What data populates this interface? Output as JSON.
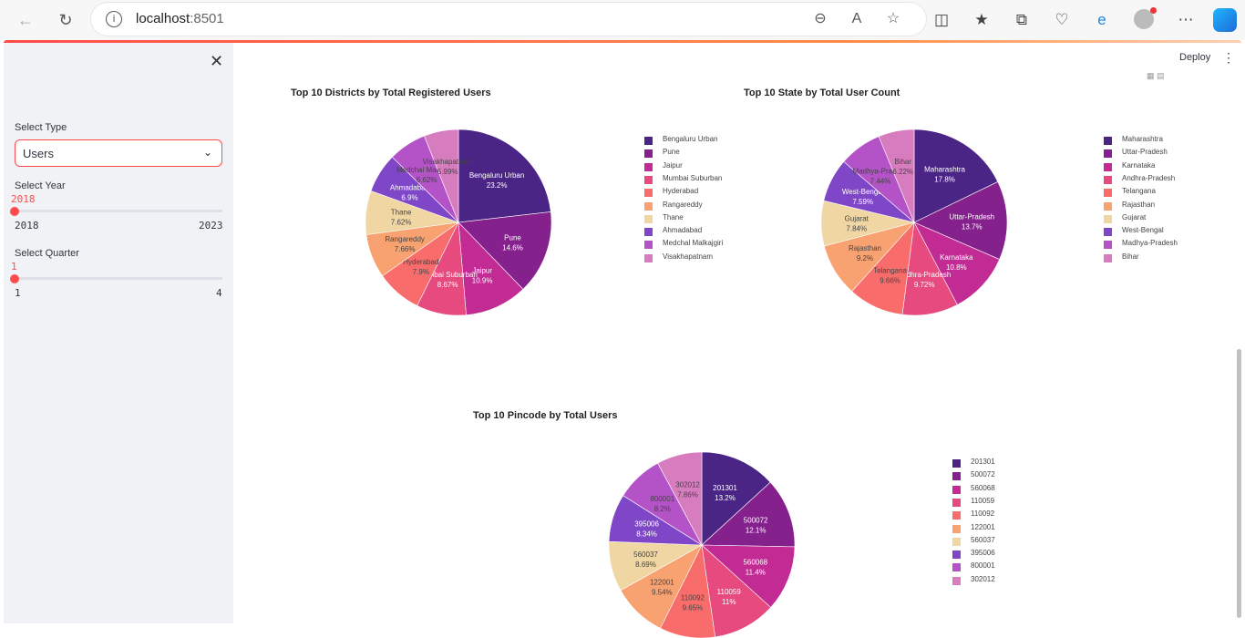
{
  "browser": {
    "url_host": "localhost",
    "url_port": ":8501"
  },
  "sidebar": {
    "type_label": "Select Type",
    "type_value": "Users",
    "year_label": "Select Year",
    "year_value": "2018",
    "year_min": "2018",
    "year_max": "2023",
    "year_position": 0,
    "quarter_label": "Select Quarter",
    "quarter_value": "1",
    "quarter_min": "1",
    "quarter_max": "4",
    "quarter_position": 0
  },
  "header": {
    "deploy_label": "Deploy"
  },
  "colors": [
    "#4b2585",
    "#84218c",
    "#c12b93",
    "#e64a7f",
    "#f86d6c",
    "#f8a171",
    "#efd6a2",
    "#7f47c8",
    "#b452c8",
    "#d87cc0"
  ],
  "chart_data": [
    {
      "type": "pie",
      "title": "Top 10 Districts by Total Registered Users",
      "labels": [
        "Bengaluru Urban",
        "Pune",
        "Jaipur",
        "Mumbai Suburban",
        "Hyderabad",
        "Rangareddy",
        "Thane",
        "Ahmadabad",
        "Medchal Malkajgiri",
        "Visakhapatnam"
      ],
      "values": [
        23.2,
        14.6,
        10.9,
        8.67,
        7.9,
        7.66,
        7.62,
        6.9,
        6.62,
        5.99
      ],
      "value_labels": [
        "23.2%",
        "14.6%",
        "10.9%",
        "8.67%",
        "7.9%",
        "7.66%",
        "7.62%",
        "6.9%",
        "6.62%",
        "5.99%"
      ],
      "legend": [
        "Bengaluru Urban",
        "Pune",
        "Jaipur",
        "Mumbai Suburban",
        "Hyderabad",
        "Rangareddy",
        "Thane",
        "Ahmadabad",
        "Medchal Malkajgiri",
        "Visakhapatnam"
      ]
    },
    {
      "type": "pie",
      "title": "Top 10 State by Total User Count",
      "labels": [
        "Maharashtra",
        "Uttar-Pradesh",
        "Karnataka",
        "Andhra-Pradesh",
        "Telangana",
        "Rajasthan",
        "Gujarat",
        "West-Bengal",
        "Madhya-Pradesh",
        "Bihar"
      ],
      "values": [
        17.8,
        13.7,
        10.8,
        9.72,
        9.66,
        9.2,
        7.84,
        7.59,
        7.44,
        6.22
      ],
      "value_labels": [
        "17.8%",
        "13.7%",
        "10.8%",
        "9.72%",
        "9.66%",
        "9.2%",
        "7.84%",
        "7.59%",
        "7.44%",
        "6.22%"
      ],
      "legend": [
        "Maharashtra",
        "Uttar-Pradesh",
        "Karnataka",
        "Andhra-Pradesh",
        "Telangana",
        "Rajasthan",
        "Gujarat",
        "West-Bengal",
        "Madhya-Pradesh",
        "Bihar"
      ]
    },
    {
      "type": "pie",
      "title": "Top 10 Pincode by Total Users",
      "labels": [
        "201301",
        "500072",
        "560068",
        "110059",
        "110092",
        "122001",
        "560037",
        "395006",
        "800001",
        "302012"
      ],
      "values": [
        13.2,
        12.1,
        11.4,
        11,
        9.65,
        9.54,
        8.69,
        8.34,
        8.2,
        7.86
      ],
      "value_labels": [
        "13.2%",
        "12.1%",
        "11.4%",
        "11%",
        "9.65%",
        "9.54%",
        "8.69%",
        "8.34%",
        "8.2%",
        "7.86%"
      ],
      "legend": [
        "201301",
        "500072",
        "560068",
        "110059",
        "110092",
        "122001",
        "560037",
        "395006",
        "800001",
        "302012"
      ]
    }
  ]
}
